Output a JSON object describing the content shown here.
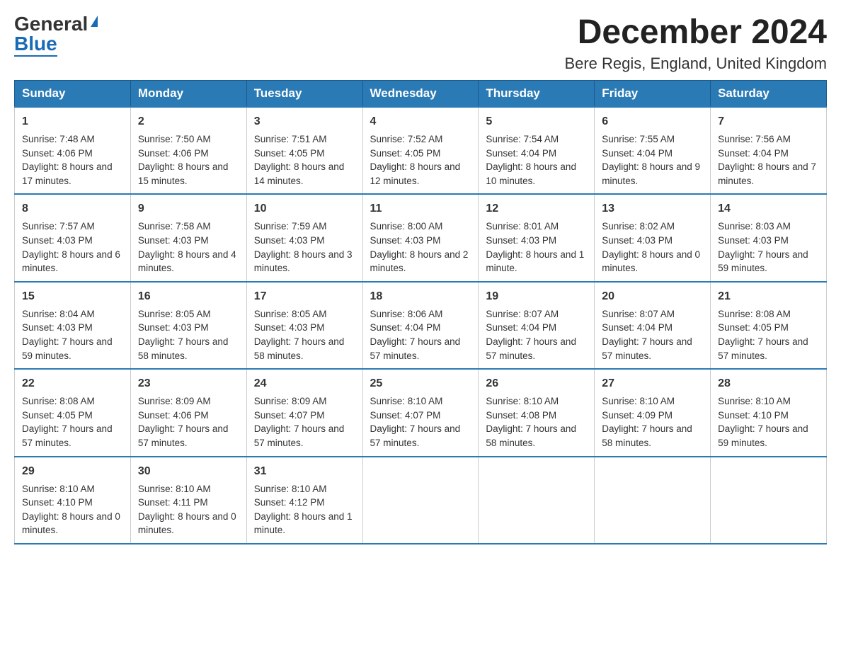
{
  "logo": {
    "general": "General",
    "blue": "Blue"
  },
  "title": "December 2024",
  "subtitle": "Bere Regis, England, United Kingdom",
  "weekdays": [
    "Sunday",
    "Monday",
    "Tuesday",
    "Wednesday",
    "Thursday",
    "Friday",
    "Saturday"
  ],
  "weeks": [
    [
      {
        "day": "1",
        "sunrise": "7:48 AM",
        "sunset": "4:06 PM",
        "daylight": "8 hours and 17 minutes."
      },
      {
        "day": "2",
        "sunrise": "7:50 AM",
        "sunset": "4:06 PM",
        "daylight": "8 hours and 15 minutes."
      },
      {
        "day": "3",
        "sunrise": "7:51 AM",
        "sunset": "4:05 PM",
        "daylight": "8 hours and 14 minutes."
      },
      {
        "day": "4",
        "sunrise": "7:52 AM",
        "sunset": "4:05 PM",
        "daylight": "8 hours and 12 minutes."
      },
      {
        "day": "5",
        "sunrise": "7:54 AM",
        "sunset": "4:04 PM",
        "daylight": "8 hours and 10 minutes."
      },
      {
        "day": "6",
        "sunrise": "7:55 AM",
        "sunset": "4:04 PM",
        "daylight": "8 hours and 9 minutes."
      },
      {
        "day": "7",
        "sunrise": "7:56 AM",
        "sunset": "4:04 PM",
        "daylight": "8 hours and 7 minutes."
      }
    ],
    [
      {
        "day": "8",
        "sunrise": "7:57 AM",
        "sunset": "4:03 PM",
        "daylight": "8 hours and 6 minutes."
      },
      {
        "day": "9",
        "sunrise": "7:58 AM",
        "sunset": "4:03 PM",
        "daylight": "8 hours and 4 minutes."
      },
      {
        "day": "10",
        "sunrise": "7:59 AM",
        "sunset": "4:03 PM",
        "daylight": "8 hours and 3 minutes."
      },
      {
        "day": "11",
        "sunrise": "8:00 AM",
        "sunset": "4:03 PM",
        "daylight": "8 hours and 2 minutes."
      },
      {
        "day": "12",
        "sunrise": "8:01 AM",
        "sunset": "4:03 PM",
        "daylight": "8 hours and 1 minute."
      },
      {
        "day": "13",
        "sunrise": "8:02 AM",
        "sunset": "4:03 PM",
        "daylight": "8 hours and 0 minutes."
      },
      {
        "day": "14",
        "sunrise": "8:03 AM",
        "sunset": "4:03 PM",
        "daylight": "7 hours and 59 minutes."
      }
    ],
    [
      {
        "day": "15",
        "sunrise": "8:04 AM",
        "sunset": "4:03 PM",
        "daylight": "7 hours and 59 minutes."
      },
      {
        "day": "16",
        "sunrise": "8:05 AM",
        "sunset": "4:03 PM",
        "daylight": "7 hours and 58 minutes."
      },
      {
        "day": "17",
        "sunrise": "8:05 AM",
        "sunset": "4:03 PM",
        "daylight": "7 hours and 58 minutes."
      },
      {
        "day": "18",
        "sunrise": "8:06 AM",
        "sunset": "4:04 PM",
        "daylight": "7 hours and 57 minutes."
      },
      {
        "day": "19",
        "sunrise": "8:07 AM",
        "sunset": "4:04 PM",
        "daylight": "7 hours and 57 minutes."
      },
      {
        "day": "20",
        "sunrise": "8:07 AM",
        "sunset": "4:04 PM",
        "daylight": "7 hours and 57 minutes."
      },
      {
        "day": "21",
        "sunrise": "8:08 AM",
        "sunset": "4:05 PM",
        "daylight": "7 hours and 57 minutes."
      }
    ],
    [
      {
        "day": "22",
        "sunrise": "8:08 AM",
        "sunset": "4:05 PM",
        "daylight": "7 hours and 57 minutes."
      },
      {
        "day": "23",
        "sunrise": "8:09 AM",
        "sunset": "4:06 PM",
        "daylight": "7 hours and 57 minutes."
      },
      {
        "day": "24",
        "sunrise": "8:09 AM",
        "sunset": "4:07 PM",
        "daylight": "7 hours and 57 minutes."
      },
      {
        "day": "25",
        "sunrise": "8:10 AM",
        "sunset": "4:07 PM",
        "daylight": "7 hours and 57 minutes."
      },
      {
        "day": "26",
        "sunrise": "8:10 AM",
        "sunset": "4:08 PM",
        "daylight": "7 hours and 58 minutes."
      },
      {
        "day": "27",
        "sunrise": "8:10 AM",
        "sunset": "4:09 PM",
        "daylight": "7 hours and 58 minutes."
      },
      {
        "day": "28",
        "sunrise": "8:10 AM",
        "sunset": "4:10 PM",
        "daylight": "7 hours and 59 minutes."
      }
    ],
    [
      {
        "day": "29",
        "sunrise": "8:10 AM",
        "sunset": "4:10 PM",
        "daylight": "8 hours and 0 minutes."
      },
      {
        "day": "30",
        "sunrise": "8:10 AM",
        "sunset": "4:11 PM",
        "daylight": "8 hours and 0 minutes."
      },
      {
        "day": "31",
        "sunrise": "8:10 AM",
        "sunset": "4:12 PM",
        "daylight": "8 hours and 1 minute."
      },
      null,
      null,
      null,
      null
    ]
  ],
  "labels": {
    "sunrise": "Sunrise:",
    "sunset": "Sunset:",
    "daylight": "Daylight:"
  }
}
